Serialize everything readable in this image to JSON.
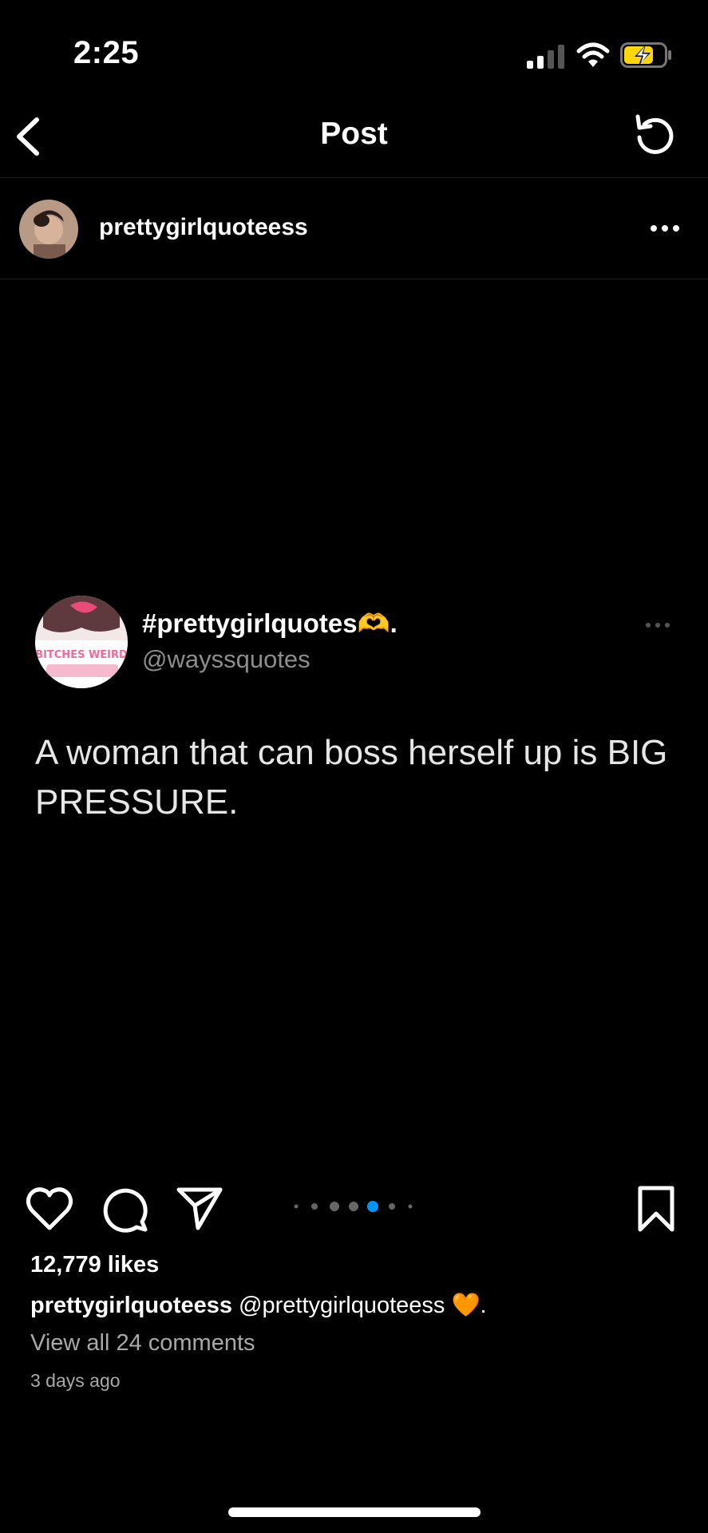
{
  "status_bar": {
    "time": "2:25"
  },
  "nav": {
    "title": "Post"
  },
  "post": {
    "username": "prettygirlquoteess",
    "tweet": {
      "display_name": "#prettygirlquotes🫶.",
      "handle": "@wayssquotes",
      "text": "A woman that can boss herself up is BIG PRESSURE.",
      "avatar_text": "BITCHES WEIRD"
    },
    "carousel": {
      "count": 7,
      "active": 4
    },
    "likes": "12,779 likes",
    "caption_user": "prettygirlquoteess",
    "caption_text": " @prettygirlquoteess 🧡.",
    "view_comments": "View all 24 comments",
    "time_ago": "3 days ago"
  },
  "colors": {
    "background": "#000000",
    "accent_blue": "#0095f6",
    "muted": "#a8a8a8",
    "battery_yellow": "#ffd60a"
  }
}
